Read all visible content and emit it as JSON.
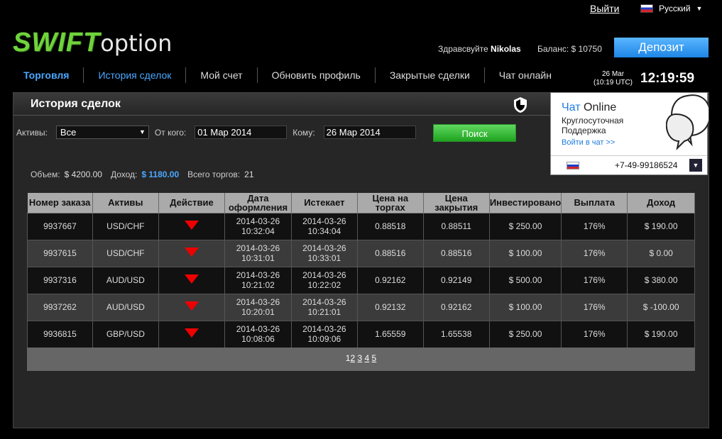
{
  "header": {
    "logout": "Выйти",
    "language": "Русский",
    "logo_main": "SWIFT",
    "logo_sub": "option",
    "greeting": "Здравсвуйте",
    "username": "Nikolas",
    "balance": "Баланс: $ 10750",
    "deposit": "Депозит"
  },
  "nav": {
    "items": [
      "Торговля",
      "История сделок",
      "Мой счет",
      "Обновить профиль",
      "Закрытые сделки",
      "Чат онлайн"
    ]
  },
  "clock": {
    "date": "26 Mar",
    "utc": "(10:19 UTC)",
    "time": "12:19:59"
  },
  "panel": {
    "title": "История сделок"
  },
  "filter": {
    "assets_label": "Активы:",
    "assets_value": "Все",
    "from_label": "От кого:",
    "from_value": "01 Мар 2014",
    "to_label": "Кому:",
    "to_value": "26 Мар 2014",
    "search": "Поиск"
  },
  "summary": {
    "volume_label": "Объем:",
    "volume": "$ 4200.00",
    "profit_label": "Доход:",
    "profit": "$ 1180.00",
    "trades_label": "Всего торгов:",
    "trades": "21"
  },
  "table": {
    "headers": [
      "Номер заказа",
      "Активы",
      "Действие",
      "Дата оформления",
      "Истекает",
      "Цена на торгах",
      "Цена закрытия",
      "Инвестировано",
      "Выплата",
      "Доход"
    ],
    "rows": [
      {
        "id": "9937667",
        "asset": "USD/CHF",
        "date1": "2014-03-26",
        "time1": "10:32:04",
        "date2": "2014-03-26",
        "time2": "10:34:04",
        "open": "0.88518",
        "close": "0.88511",
        "invested": "$ 250.00",
        "payout": "176%",
        "profit": "$ 190.00"
      },
      {
        "id": "9937615",
        "asset": "USD/CHF",
        "date1": "2014-03-26",
        "time1": "10:31:01",
        "date2": "2014-03-26",
        "time2": "10:33:01",
        "open": "0.88516",
        "close": "0.88516",
        "invested": "$ 100.00",
        "payout": "176%",
        "profit": "$ 0.00"
      },
      {
        "id": "9937316",
        "asset": "AUD/USD",
        "date1": "2014-03-26",
        "time1": "10:21:02",
        "date2": "2014-03-26",
        "time2": "10:22:02",
        "open": "0.92162",
        "close": "0.92149",
        "invested": "$ 500.00",
        "payout": "176%",
        "profit": "$ 380.00"
      },
      {
        "id": "9937262",
        "asset": "AUD/USD",
        "date1": "2014-03-26",
        "time1": "10:20:01",
        "date2": "2014-03-26",
        "time2": "10:21:01",
        "open": "0.92132",
        "close": "0.92162",
        "invested": "$ 100.00",
        "payout": "176%",
        "profit": "$ -100.00"
      },
      {
        "id": "9936815",
        "asset": "GBP/USD",
        "date1": "2014-03-26",
        "time1": "10:08:06",
        "date2": "2014-03-26",
        "time2": "10:09:06",
        "open": "1.65559",
        "close": "1.65538",
        "invested": "$ 250.00",
        "payout": "176%",
        "profit": "$ 190.00"
      }
    ]
  },
  "pagination": {
    "pages": [
      "1",
      "2",
      "3",
      "4",
      "5"
    ],
    "current": "1"
  },
  "chat": {
    "title_part1": "Чат",
    "title_part2": " Online",
    "subtitle": "Круглосуточная Поддержка",
    "link": "Войти в чат >>",
    "phone": "+7-49-99186524"
  },
  "colors": {
    "accent_blue": "#4aa8ff",
    "logo_green": "#6fd33b",
    "search_green": "#2bbd2b",
    "deposit_blue": "#2a93ef",
    "down_arrow_red": "#e00000"
  },
  "icons": {
    "action": "down-arrow-icon",
    "shield": "shield-icon",
    "chat": "speech-bubbles-icon"
  }
}
